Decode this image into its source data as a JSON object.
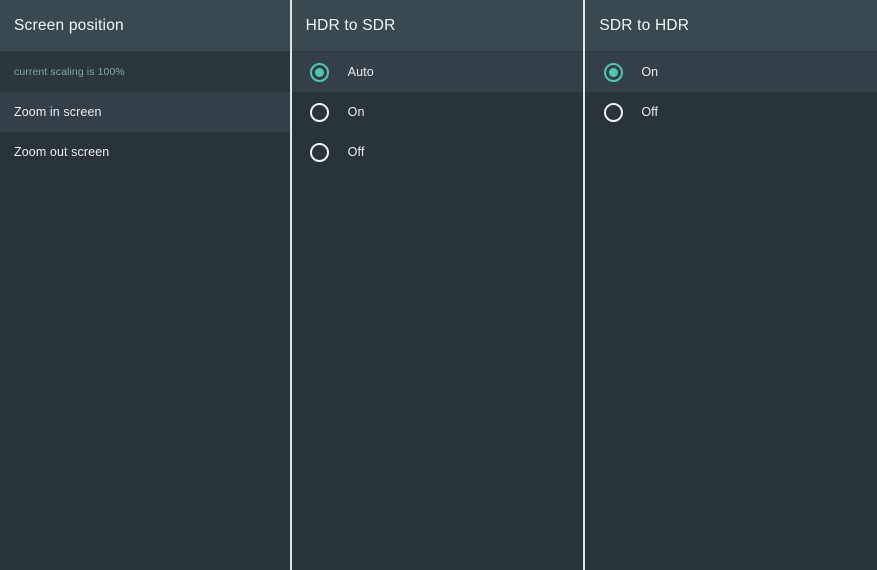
{
  "theme": {
    "background": "#28333a",
    "header_background": "#3a4850",
    "row_highlight": "#343f47",
    "row_alt": "#2b363d",
    "divider": "#dfe4e6",
    "accent": "#4ec9ad",
    "text_primary": "#e8edef",
    "text_muted": "#82a89e"
  },
  "columns": [
    {
      "header": "Screen position",
      "rows": [
        {
          "label": "current scaling is 100%",
          "style": "info",
          "selected": false
        },
        {
          "label": "Zoom in screen",
          "style": "normal",
          "selected": true
        },
        {
          "label": "Zoom out screen",
          "style": "normal",
          "selected": false
        }
      ]
    },
    {
      "header": "HDR to SDR",
      "options": [
        {
          "label": "Auto",
          "checked": true
        },
        {
          "label": "On",
          "checked": false
        },
        {
          "label": "Off",
          "checked": false
        }
      ]
    },
    {
      "header": "SDR to HDR",
      "options": [
        {
          "label": "On",
          "checked": true
        },
        {
          "label": "Off",
          "checked": false
        }
      ]
    }
  ]
}
